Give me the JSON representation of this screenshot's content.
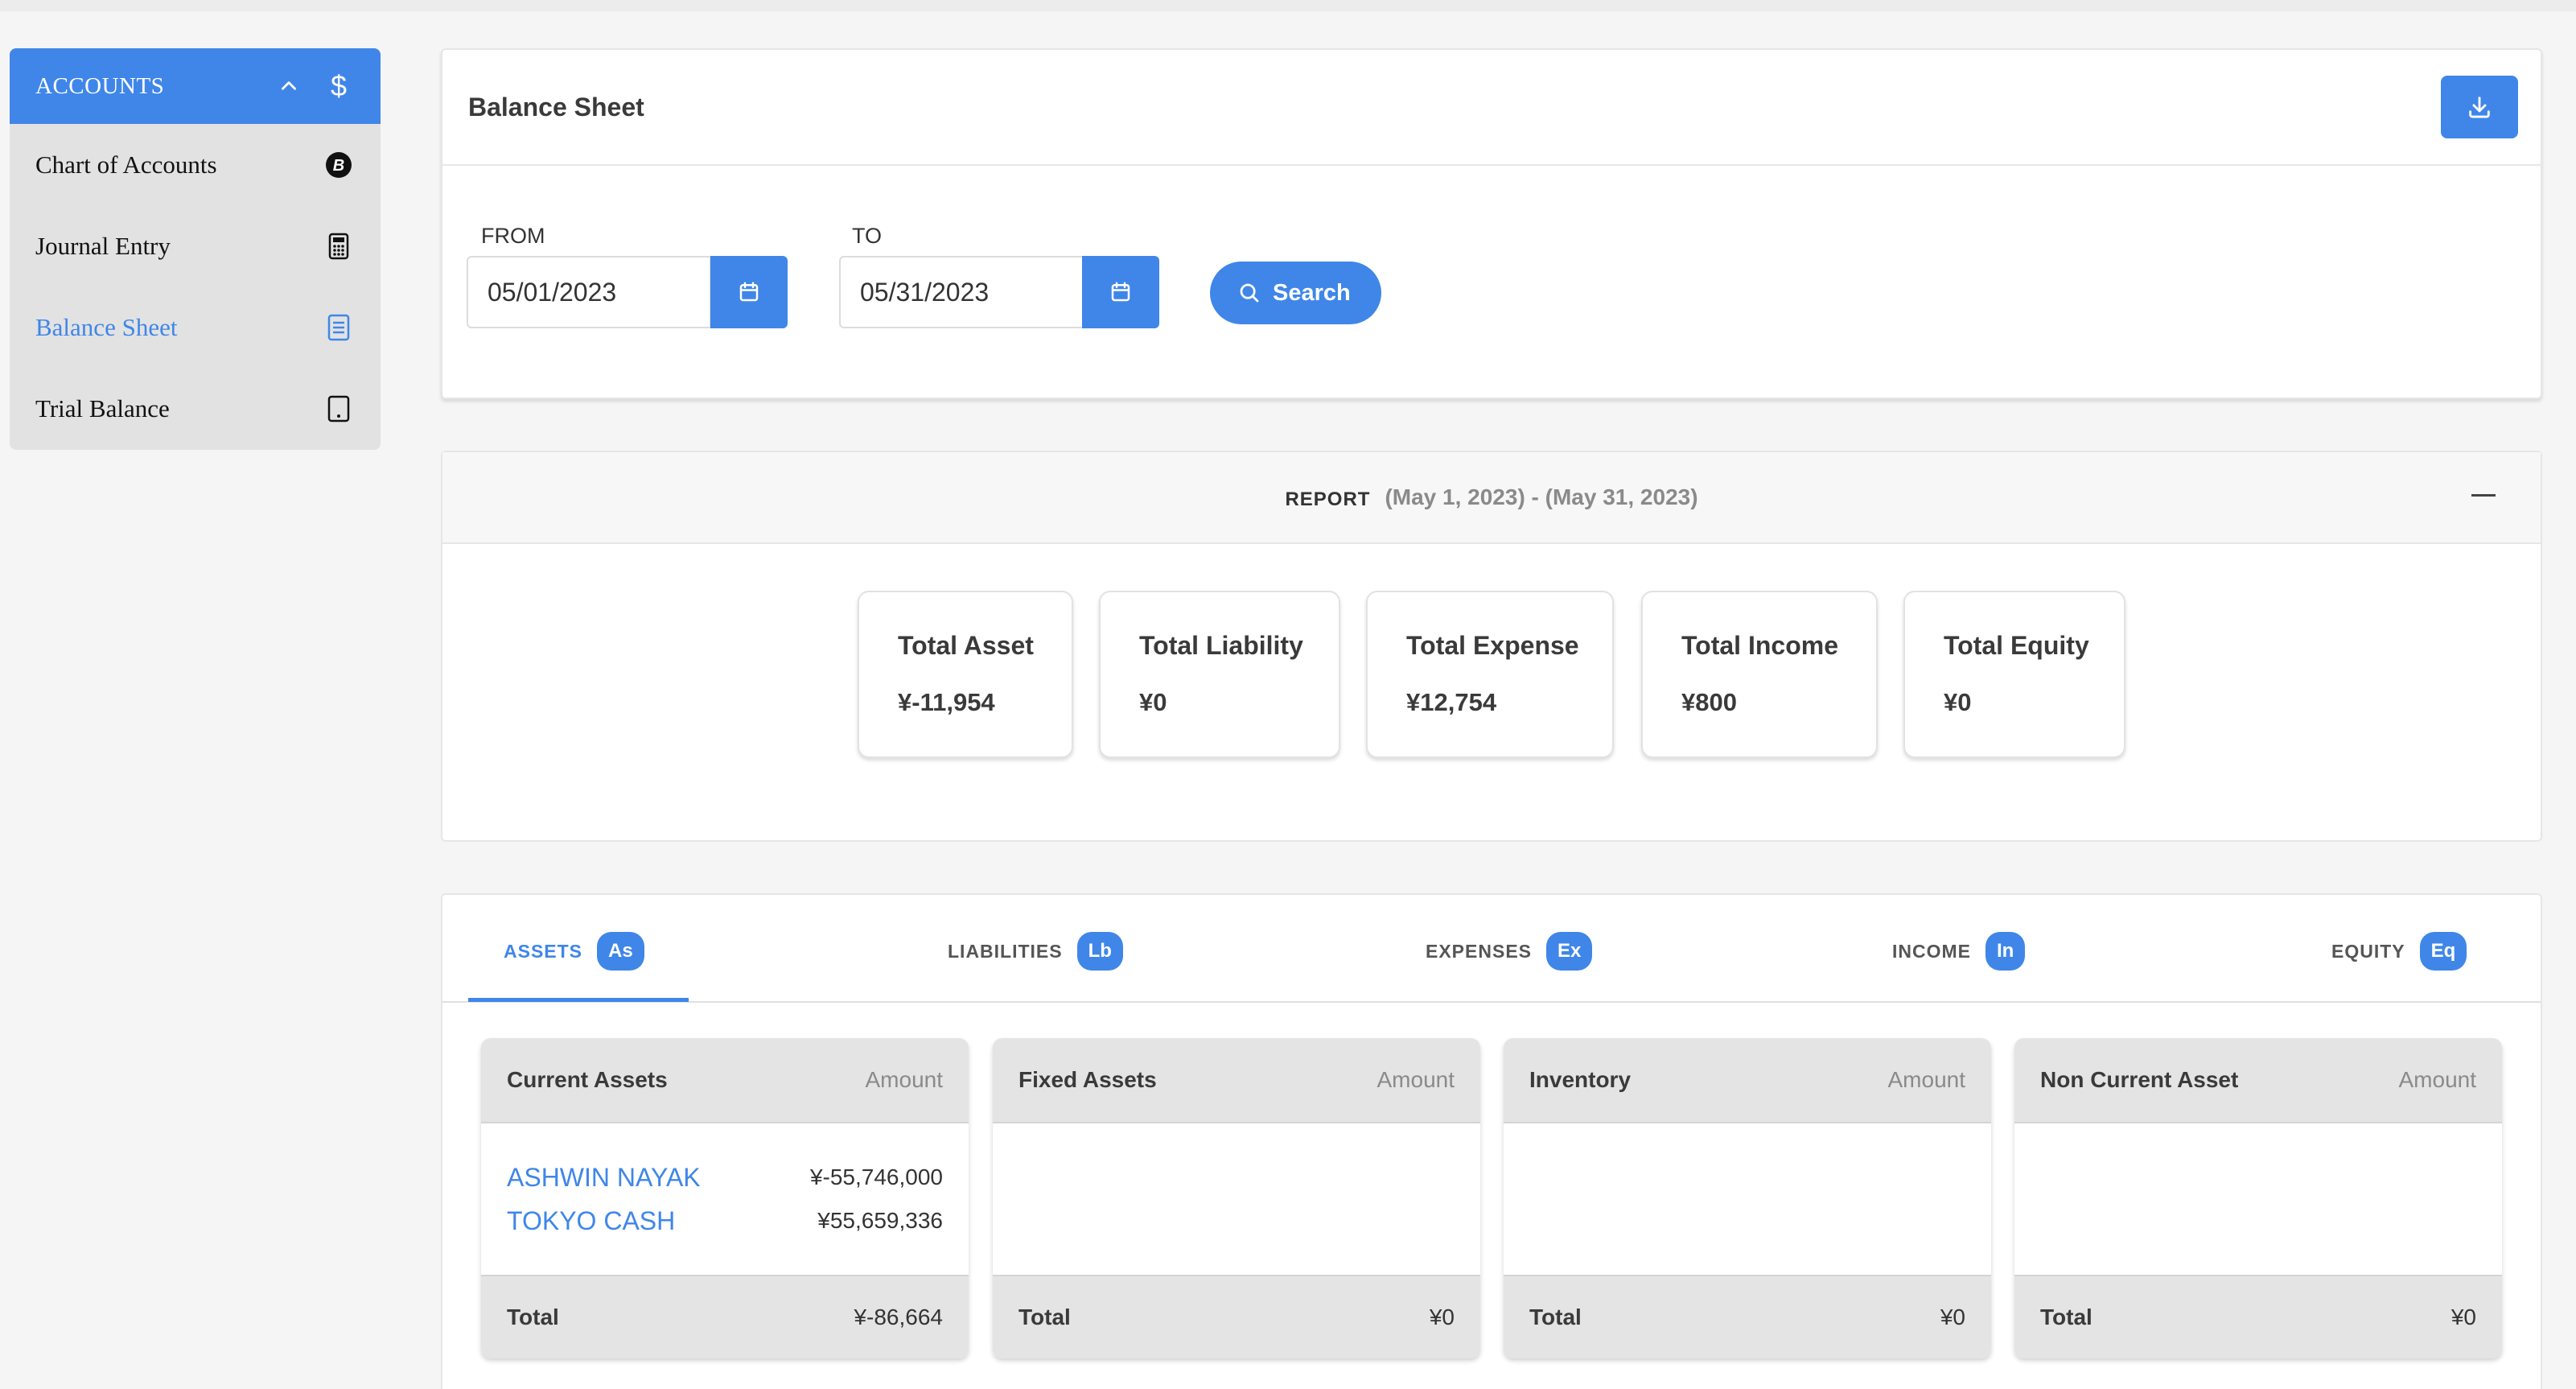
{
  "sidebar": {
    "header": "ACCOUNTS",
    "items": [
      {
        "label": "Chart of Accounts",
        "icon": "bitcoin-icon",
        "active": false
      },
      {
        "label": "Journal Entry",
        "icon": "calculator-icon",
        "active": false
      },
      {
        "label": "Balance Sheet",
        "icon": "document-list-icon",
        "active": true
      },
      {
        "label": "Trial Balance",
        "icon": "tablet-icon",
        "active": false
      }
    ]
  },
  "balance_sheet": {
    "title": "Balance Sheet",
    "from_label": "FROM",
    "from_value": "05/01/2023",
    "to_label": "TO",
    "to_value": "05/31/2023",
    "search_label": "Search"
  },
  "report": {
    "label": "REPORT",
    "range": "(May 1, 2023) - (May 31, 2023)",
    "stats": [
      {
        "title": "Total Asset",
        "value": "¥-11,954"
      },
      {
        "title": "Total Liability",
        "value": "¥0"
      },
      {
        "title": "Total Expense",
        "value": "¥12,754"
      },
      {
        "title": "Total Income",
        "value": "¥800"
      },
      {
        "title": "Total Equity",
        "value": "¥0"
      }
    ]
  },
  "tabs": [
    {
      "label": "ASSETS",
      "badge": "As",
      "active": true
    },
    {
      "label": "LIABILITIES",
      "badge": "Lb",
      "active": false
    },
    {
      "label": "EXPENSES",
      "badge": "Ex",
      "active": false
    },
    {
      "label": "INCOME",
      "badge": "In",
      "active": false
    },
    {
      "label": "EQUITY",
      "badge": "Eq",
      "active": false
    }
  ],
  "asset_groups": [
    {
      "title": "Current Assets",
      "amount_label": "Amount",
      "rows": [
        {
          "name": "ASHWIN NAYAK",
          "amount": "¥-55,746,000"
        },
        {
          "name": "TOKYO CASH",
          "amount": "¥55,659,336"
        }
      ],
      "total_label": "Total",
      "total": "¥-86,664"
    },
    {
      "title": "Fixed Assets",
      "amount_label": "Amount",
      "rows": [],
      "total_label": "Total",
      "total": "¥0"
    },
    {
      "title": "Inventory",
      "amount_label": "Amount",
      "rows": [],
      "total_label": "Total",
      "total": "¥0"
    },
    {
      "title": "Non Current Asset",
      "amount_label": "Amount",
      "rows": [],
      "total_label": "Total",
      "total": "¥0"
    }
  ],
  "colors": {
    "accent": "#3f86e8",
    "sidebar_bg": "#e2e2e2",
    "header_bg": "#e4e4e4"
  }
}
